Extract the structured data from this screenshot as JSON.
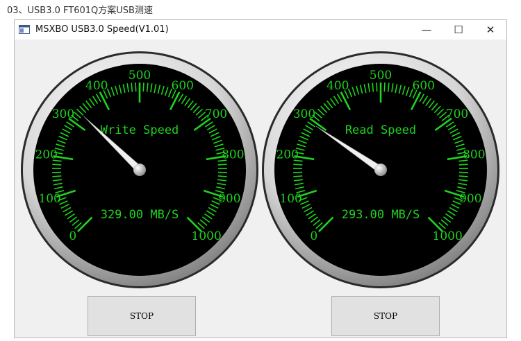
{
  "caption": "03、USB3.0 FT601Q方案USB测速",
  "window": {
    "title": "MSXBO USB3.0 Speed(V1.01)",
    "controls": {
      "minimize": "—",
      "maximize": "☐",
      "close": "✕"
    }
  },
  "gauges": [
    {
      "title": "Write Speed",
      "reading": "329.00 MB/S",
      "value": 329,
      "scale_labels": [
        "0",
        "100",
        "200",
        "300",
        "400",
        "500",
        "600",
        "700",
        "800",
        "900",
        "1000"
      ]
    },
    {
      "title": "Read Speed",
      "reading": "293.00 MB/S",
      "value": 293,
      "scale_labels": [
        "0",
        "100",
        "200",
        "300",
        "400",
        "500",
        "600",
        "700",
        "800",
        "900",
        "1000"
      ]
    }
  ],
  "buttons": {
    "write_stop": "STOP",
    "read_stop": "STOP"
  },
  "colors": {
    "dial_face": "#000000",
    "scale_green": "#1fd31f",
    "needle": "#f0f0f0"
  }
}
